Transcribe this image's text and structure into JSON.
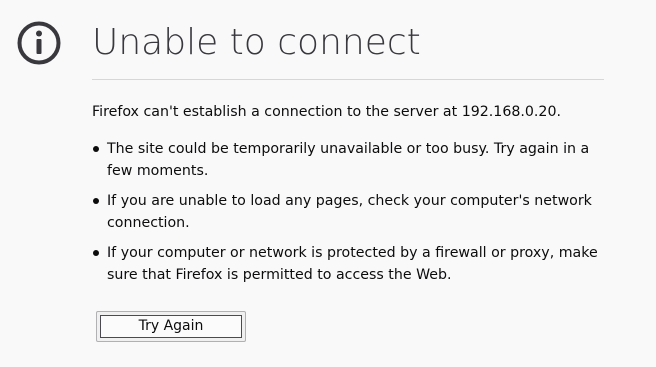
{
  "page": {
    "icon": "info-icon",
    "title": "Unable to connect",
    "description": "Firefox can't establish a connection to the server at 192.168.0.20.",
    "advice": [
      "The site could be temporarily unavailable or too busy. Try again in a few moments.",
      "If you are unable to load any pages, check your computer's network connection.",
      "If your computer or network is protected by a firewall or proxy, make sure that Firefox is permitted to access the Web."
    ],
    "try_again_label": "Try Again"
  },
  "colors": {
    "background": "#f9f9fa",
    "icon": "#38383d",
    "title": "#38383d",
    "text": "#0c0c0d",
    "divider": "#d7d7db"
  }
}
